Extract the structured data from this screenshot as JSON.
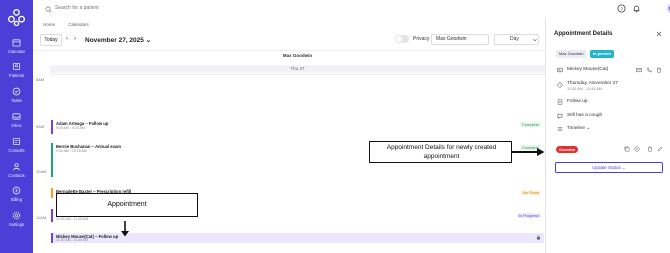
{
  "sidebar": {
    "items": [
      {
        "label": "Calendar",
        "icon": "calendar-icon"
      },
      {
        "label": "Patients",
        "icon": "patients-icon"
      },
      {
        "label": "Tasks",
        "icon": "tasks-icon"
      },
      {
        "label": "Inbox",
        "icon": "inbox-icon"
      },
      {
        "label": "Consults",
        "icon": "consults-icon"
      },
      {
        "label": "Contacts",
        "icon": "contacts-icon"
      },
      {
        "label": "Billing",
        "icon": "billing-icon"
      },
      {
        "label": "Settings",
        "icon": "settings-icon"
      }
    ]
  },
  "topbar": {
    "search_placeholder": "Search for a patient",
    "avatar_initials": "MG",
    "add_label": "+"
  },
  "breadcrumb": [
    "Home",
    "Calendars"
  ],
  "toolbar": {
    "today_label": "Today",
    "prev_label": "‹",
    "next_label": "›",
    "date_title": "November 27, 2025 ⌄",
    "privacy_label": "Privacy",
    "provider_value": "Max Goodwin",
    "view_value": "Day"
  },
  "calendar": {
    "column_header": "Max Goodwin",
    "day_header": "Thu 27",
    "hours": [
      "8AM",
      "9AM",
      "10AM",
      "11AM"
    ],
    "appointments": [
      {
        "title": "Adam Arteaga – Follow up",
        "time": "9:00 AM - 9:15 AM",
        "status": "Complete",
        "status_kind": "complete",
        "color": "#7c3aed"
      },
      {
        "title": "Bernie Buchanan – Annual exam",
        "time": "9:30 AM - 10:15 AM",
        "status": "Complete",
        "status_kind": "complete",
        "color": "#21a37a"
      },
      {
        "title": "Bernadette Baxter – Prescription refill",
        "time": "10:30 AM - 10:45 AM",
        "status": "No Show",
        "status_kind": "noshow",
        "color": "#f0a020"
      },
      {
        "title": "",
        "time": "11:00 AM - 11:15 AM",
        "status": "In Progress",
        "status_kind": "progress",
        "color": "#7c3aed"
      },
      {
        "title": "Mickey Mouse(Cat) – Follow up",
        "time": "11:30 AM - 11:45 AM",
        "status": "",
        "status_kind": "selected",
        "color": "#7c3aed"
      }
    ]
  },
  "annotations": {
    "details_box": "Appointment Details for newly created appointment",
    "appt_box": "Appointment"
  },
  "panel": {
    "title": "Appointment Details",
    "provider_tag": "Max Goodwin",
    "visit_tag": "In person",
    "patient": "Mickey Mouse(Cat)",
    "date": "Thursday, November 27",
    "time": "11:30 AM - 11:45 AM",
    "reason": "Follow up",
    "note": "Still has a cough",
    "timeline_label": "Timeline ⌄",
    "overdue_label": "Overdue",
    "update_status_label": "Update Status ⌄"
  }
}
